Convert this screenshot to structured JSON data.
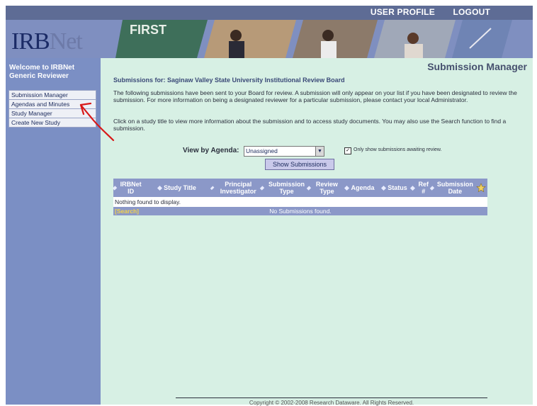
{
  "header": {
    "user_profile": "USER PROFILE",
    "logout": "LOGOUT",
    "logo_main": "IRB",
    "logo_net": "Net"
  },
  "sidebar": {
    "welcome_line1": "Welcome to IRBNet",
    "welcome_line2": "Generic Reviewer",
    "items": [
      {
        "label": "Submission Manager"
      },
      {
        "label": "Agendas and Minutes"
      },
      {
        "label": "Study Manager"
      },
      {
        "label": "Create New Study"
      }
    ]
  },
  "main": {
    "title": "Submission Manager",
    "subhead": "Submissions for: Saginaw Valley State University Institutional Review Board",
    "para1": "The following submissions have been sent to your Board for review. A submission will only appear on your list if you have been designated to review the submission. For more information on being a designated reviewer for a particular submission, please contact your local Administrator.",
    "para2": "Click on a study title to view more information about the submission and to access study documents. You may also use the Search function to find a submission.",
    "agenda_label": "View by Agenda:",
    "agenda_value": "Unassigned",
    "checkbox_label": "Only show submissions awaiting review.",
    "show_button": "Show Submissions",
    "columns": [
      {
        "label": "IRBNet ID"
      },
      {
        "label": "Study Title"
      },
      {
        "label": "Principal Investigator"
      },
      {
        "label": "Submission Type"
      },
      {
        "label": "Review Type"
      },
      {
        "label": "Agenda"
      },
      {
        "label": "Status"
      },
      {
        "label": "Ref #"
      },
      {
        "label": "Submission Date"
      }
    ],
    "empty_text": "Nothing found to display.",
    "search_label": "[Search]",
    "no_submissions": "No Submissions found.",
    "copyright": "Copyright © 2002-2008 Research Dataware. All Rights Reserved."
  },
  "colors": {
    "topbar": "#5e6c95",
    "sidebar": "#7b8fc4",
    "main_bg": "#d7f0e4",
    "grid_header": "#8b98c8",
    "annotation": "#d81818"
  }
}
